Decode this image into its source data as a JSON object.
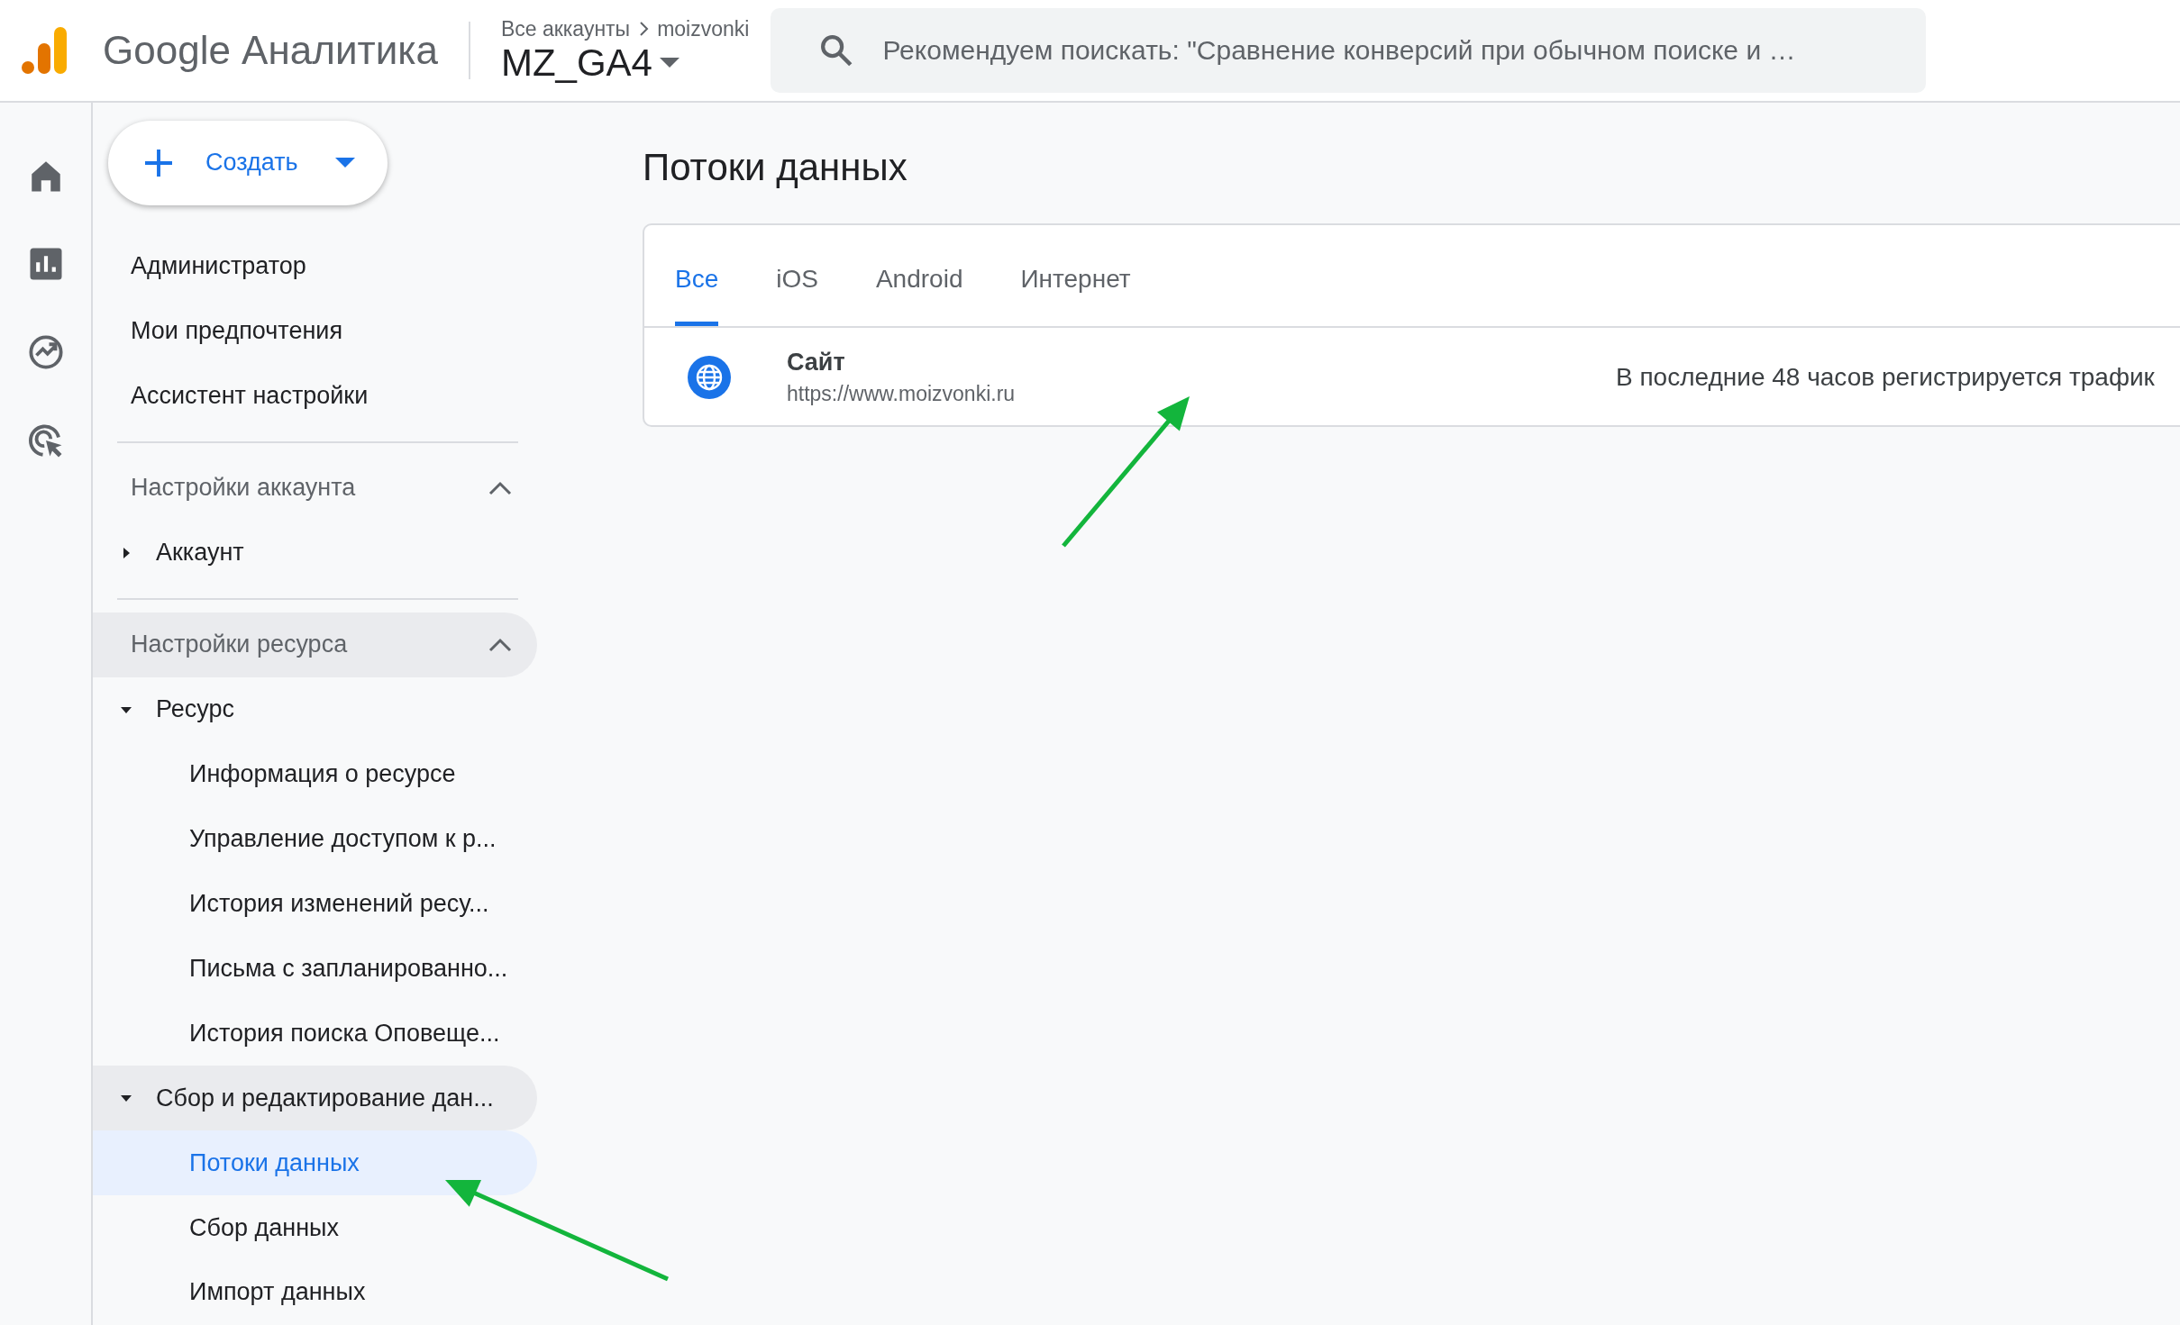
{
  "header": {
    "product": "Google Аналитика",
    "breadcrumb": {
      "parent": "Все аккаунты",
      "account": "moizvonki"
    },
    "property": "MZ_GA4",
    "search": {
      "placeholder": "Рекомендуем поискать: \"Сравнение конверсий при обычном поиске и …"
    }
  },
  "sidebar": {
    "create_button": "Создать",
    "top_items": [
      "Администратор",
      "Мои предпочтения",
      "Ассистент настройки"
    ],
    "sections": [
      {
        "label": "Настройки аккаунта",
        "expanded": true,
        "active": false,
        "items": [
          {
            "label": "Аккаунт",
            "expanded": false,
            "active": false,
            "selected": false
          }
        ]
      },
      {
        "label": "Настройки ресурса",
        "expanded": true,
        "active": true,
        "items": [
          {
            "label": "Ресурс",
            "expanded": true,
            "active": false,
            "selected": false,
            "children": [
              {
                "label": "Информация о ресурсе",
                "selected": false,
                "active": false
              },
              {
                "label": "Управление доступом к р...",
                "selected": false,
                "active": false
              },
              {
                "label": "История изменений ресу...",
                "selected": false,
                "active": false
              },
              {
                "label": "Письма с запланированно...",
                "selected": false,
                "active": false
              },
              {
                "label": "История поиска Оповеще...",
                "selected": false,
                "active": false
              }
            ]
          },
          {
            "label": "Сбор и редактирование дан...",
            "expanded": true,
            "active": true,
            "selected": false,
            "children": [
              {
                "label": "Потоки данных",
                "selected": true,
                "active": false
              },
              {
                "label": "Сбор данных",
                "selected": false,
                "active": false
              },
              {
                "label": "Импорт данных",
                "selected": false,
                "active": false
              }
            ]
          }
        ]
      }
    ]
  },
  "main": {
    "title": "Потоки данных",
    "tabs": [
      {
        "label": "Все",
        "selected": true
      },
      {
        "label": "iOS",
        "selected": false
      },
      {
        "label": "Android",
        "selected": false
      },
      {
        "label": "Интернет",
        "selected": false
      }
    ],
    "streams": [
      {
        "name": "Сайт",
        "url": "https://www.moizvonki.ru",
        "status": "В последние 48 часов регистрируется трафик"
      }
    ]
  }
}
